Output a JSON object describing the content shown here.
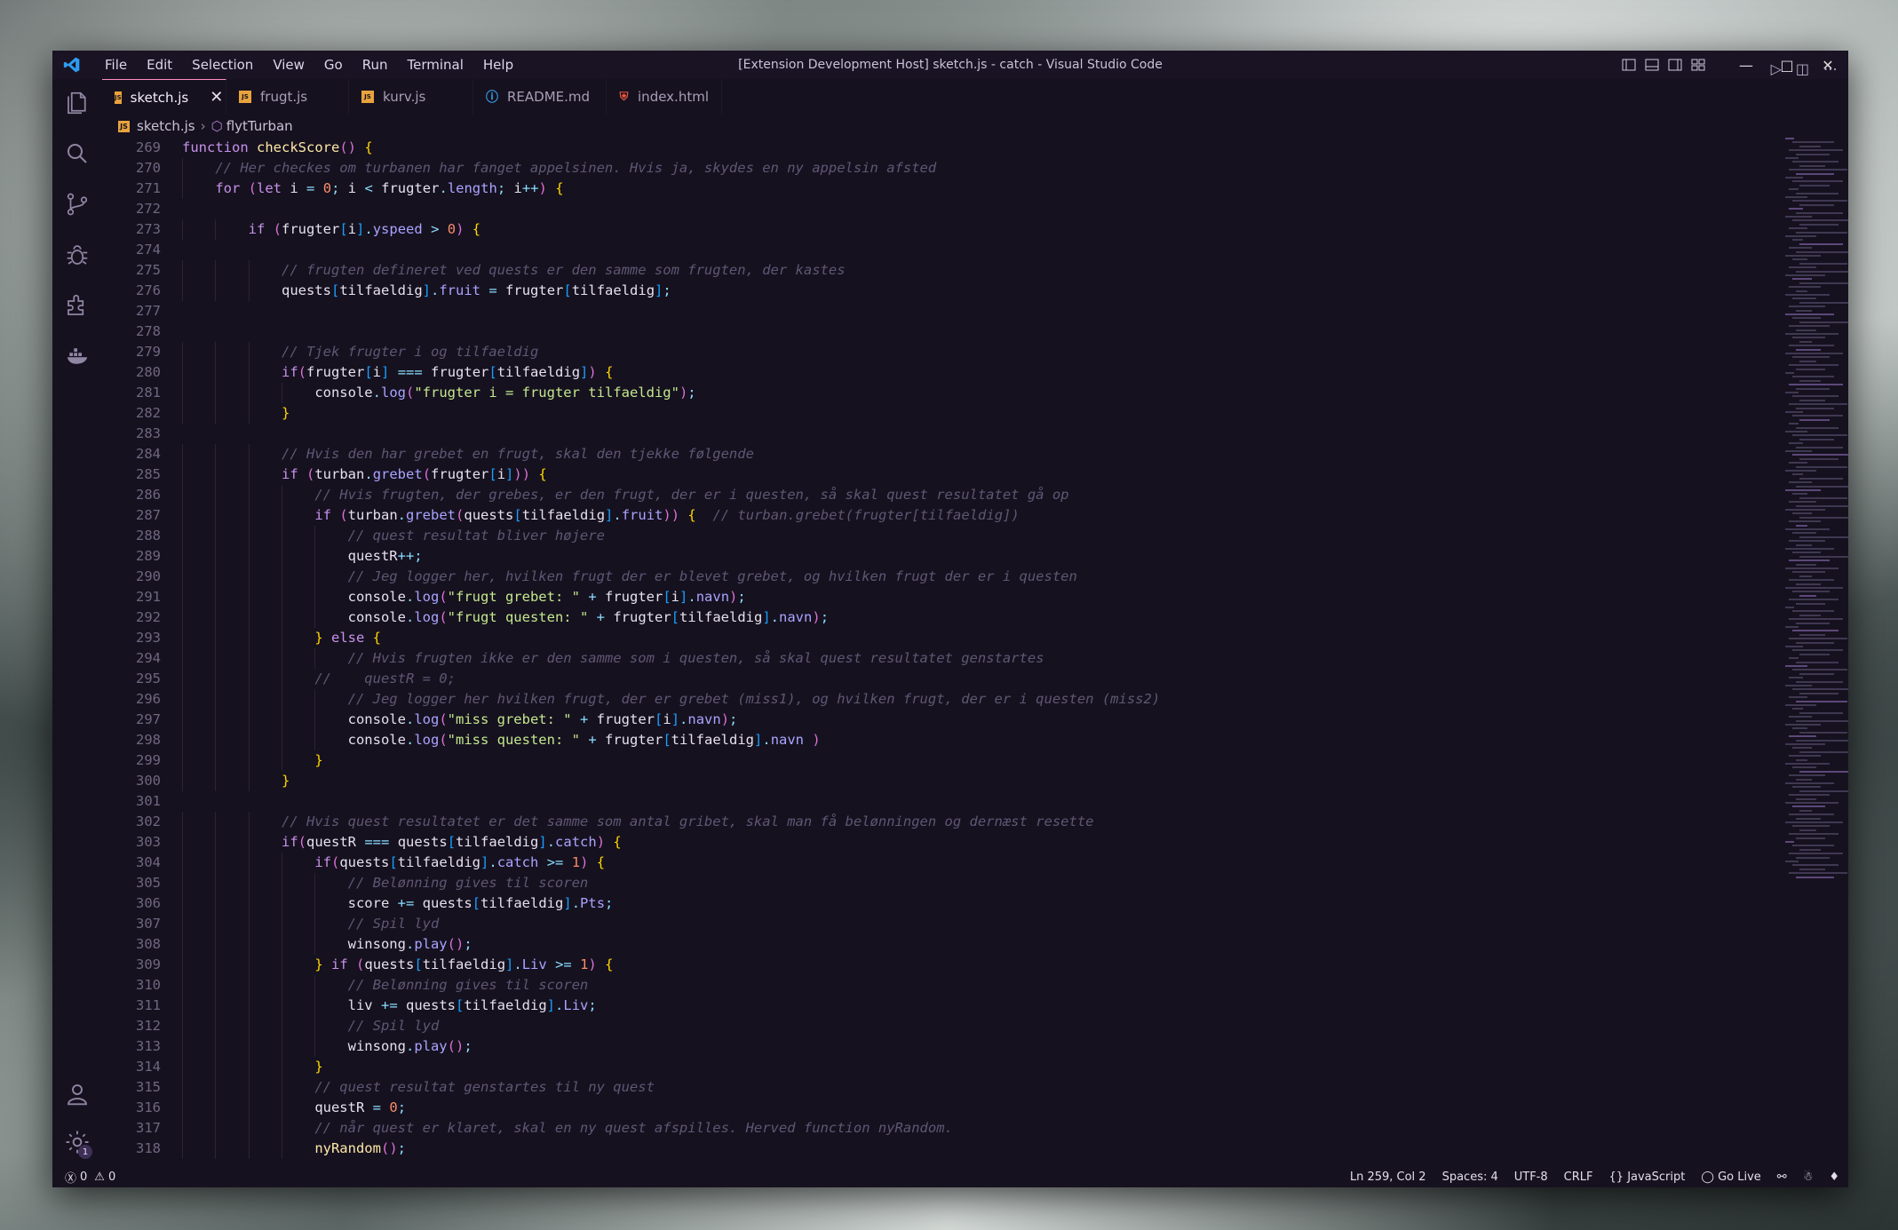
{
  "window": {
    "title": "[Extension Development Host] sketch.js - catch - Visual Studio Code"
  },
  "menu": [
    "File",
    "Edit",
    "Selection",
    "View",
    "Go",
    "Run",
    "Terminal",
    "Help"
  ],
  "activity_icons": [
    "files-icon",
    "search-icon",
    "source-control-icon",
    "debug-icon",
    "extensions-icon",
    "docker-icon"
  ],
  "settings_badge": "1",
  "tabs": [
    {
      "label": "sketch.js",
      "icon": "js",
      "active": true
    },
    {
      "label": "frugt.js",
      "icon": "js",
      "active": false
    },
    {
      "label": "kurv.js",
      "icon": "js",
      "active": false
    },
    {
      "label": "README.md",
      "icon": "info",
      "active": false
    },
    {
      "label": "index.html",
      "icon": "html",
      "active": false
    }
  ],
  "breadcrumb": {
    "file": "sketch.js",
    "symbol": "flytTurban"
  },
  "code": [
    {
      "n": "269",
      "t": "function checkScore() {"
    },
    {
      "n": "270",
      "t": "    // Her checkes om turbanen har fanget appelsinen. Hvis ja, skydes en ny appelsin afsted"
    },
    {
      "n": "271",
      "t": "    for (let i = 0; i < frugter.length; i++) {"
    },
    {
      "n": "272",
      "t": ""
    },
    {
      "n": "273",
      "t": "        if (frugter[i].yspeed > 0) {"
    },
    {
      "n": "274",
      "t": ""
    },
    {
      "n": "275",
      "t": "            // frugten defineret ved quests er den samme som frugten, der kastes"
    },
    {
      "n": "276",
      "t": "            quests[tilfaeldig].fruit = frugter[tilfaeldig];"
    },
    {
      "n": "277",
      "t": ""
    },
    {
      "n": "278",
      "t": ""
    },
    {
      "n": "279",
      "t": "            // Tjek frugter i og tilfaeldig"
    },
    {
      "n": "280",
      "t": "            if(frugter[i] === frugter[tilfaeldig]) {"
    },
    {
      "n": "281",
      "t": "                console.log(\"frugter i = frugter tilfaeldig\");"
    },
    {
      "n": "282",
      "t": "            }"
    },
    {
      "n": "283",
      "t": ""
    },
    {
      "n": "284",
      "t": "            // Hvis den har grebet en frugt, skal den tjekke følgende"
    },
    {
      "n": "285",
      "t": "            if (turban.grebet(frugter[i])) {"
    },
    {
      "n": "286",
      "t": "                // Hvis frugten, der grebes, er den frugt, der er i questen, så skal quest resultatet gå op"
    },
    {
      "n": "287",
      "t": "                if (turban.grebet(quests[tilfaeldig].fruit)) {  // turban.grebet(frugter[tilfaeldig])"
    },
    {
      "n": "288",
      "t": "                    // quest resultat bliver højere"
    },
    {
      "n": "289",
      "t": "                    questR++;"
    },
    {
      "n": "290",
      "t": "                    // Jeg logger her, hvilken frugt der er blevet grebet, og hvilken frugt der er i questen"
    },
    {
      "n": "291",
      "t": "                    console.log(\"frugt grebet: \" + frugter[i].navn);"
    },
    {
      "n": "292",
      "t": "                    console.log(\"frugt questen: \" + frugter[tilfaeldig].navn);"
    },
    {
      "n": "293",
      "t": "                } else {"
    },
    {
      "n": "294",
      "t": "                    // Hvis frugten ikke er den samme som i questen, så skal quest resultatet genstartes"
    },
    {
      "n": "295",
      "t": "                //    questR = 0;"
    },
    {
      "n": "296",
      "t": "                    // Jeg logger her hvilken frugt, der er grebet (miss1), og hvilken frugt, der er i questen (miss2)"
    },
    {
      "n": "297",
      "t": "                    console.log(\"miss grebet: \" + frugter[i].navn);"
    },
    {
      "n": "298",
      "t": "                    console.log(\"miss questen: \" + frugter[tilfaeldig].navn )"
    },
    {
      "n": "299",
      "t": "                }"
    },
    {
      "n": "300",
      "t": "            }"
    },
    {
      "n": "301",
      "t": ""
    },
    {
      "n": "302",
      "t": "            // Hvis quest resultatet er det samme som antal gribet, skal man få belønningen og dernæst resette"
    },
    {
      "n": "303",
      "t": "            if(questR === quests[tilfaeldig].catch) {"
    },
    {
      "n": "304",
      "t": "                if(quests[tilfaeldig].catch >= 1) {"
    },
    {
      "n": "305",
      "t": "                    // Belønning gives til scoren"
    },
    {
      "n": "306",
      "t": "                    score += quests[tilfaeldig].Pts;"
    },
    {
      "n": "307",
      "t": "                    // Spil lyd"
    },
    {
      "n": "308",
      "t": "                    winsong.play();"
    },
    {
      "n": "309",
      "t": "                } if (quests[tilfaeldig].Liv >= 1) {"
    },
    {
      "n": "310",
      "t": "                    // Belønning gives til scoren"
    },
    {
      "n": "311",
      "t": "                    liv += quests[tilfaeldig].Liv;"
    },
    {
      "n": "312",
      "t": "                    // Spil lyd"
    },
    {
      "n": "313",
      "t": "                    winsong.play();"
    },
    {
      "n": "314",
      "t": "                }"
    },
    {
      "n": "315",
      "t": "                // quest resultat genstartes til ny quest"
    },
    {
      "n": "316",
      "t": "                questR = 0;"
    },
    {
      "n": "317",
      "t": "                // når quest er klaret, skal en ny quest afspilles. Herved function nyRandom."
    },
    {
      "n": "318",
      "t": "                nyRandom();"
    }
  ],
  "status": {
    "errors": "0",
    "warnings": "0",
    "position": "Ln 259, Col 2",
    "spaces": "Spaces: 4",
    "encoding": "UTF-8",
    "eol": "CRLF",
    "language": "JavaScript",
    "golive": "Go Live"
  },
  "colors": {
    "accent": "#ff8ec2",
    "bg": "#16111f",
    "comment": "#5e5774",
    "keyword": "#c792ea"
  }
}
